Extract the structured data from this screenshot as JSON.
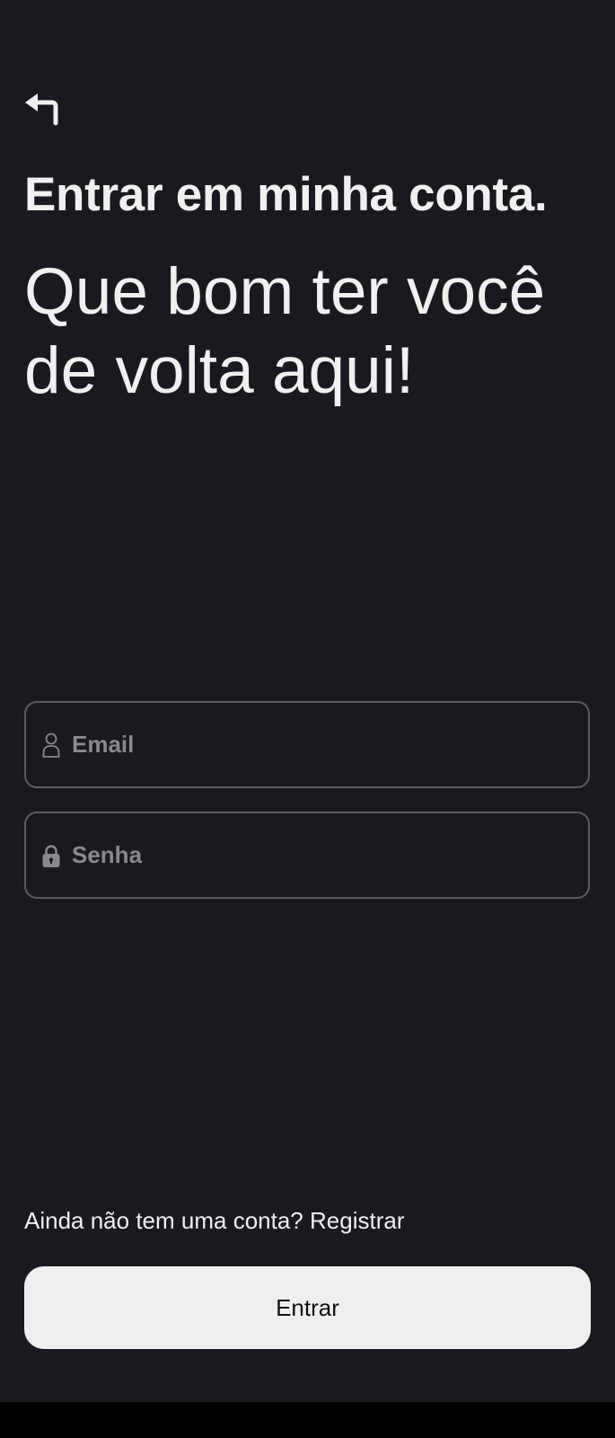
{
  "header": {
    "back_icon": "back-arrow-icon",
    "title": "Entrar em minha conta.",
    "subtitle": "Que bom ter você de volta aqui!"
  },
  "form": {
    "email": {
      "icon": "user-icon",
      "placeholder": "Email",
      "value": ""
    },
    "password": {
      "icon": "lock-icon",
      "placeholder": "Senha",
      "value": ""
    }
  },
  "footer": {
    "register_prompt": "Ainda não tem uma conta?",
    "register_link": "Registrar",
    "submit_label": "Entrar"
  },
  "colors": {
    "background": "#1a1920",
    "text": "#f0f0f0",
    "placeholder": "#8a8990",
    "field_border": "#5d5c64",
    "button_background": "#efefef",
    "button_text": "#111111"
  }
}
